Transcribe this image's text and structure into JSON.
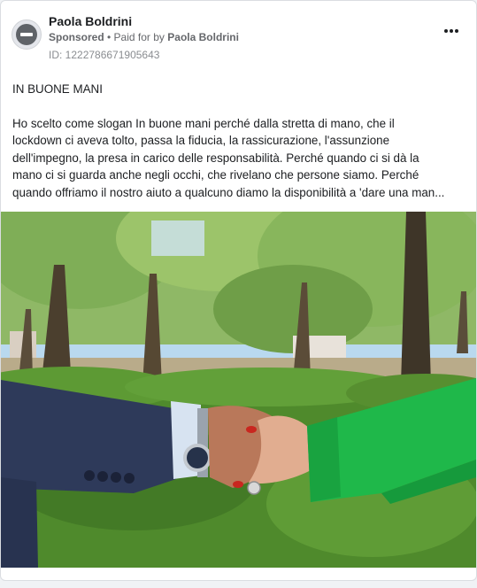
{
  "post": {
    "author": "Paola Boldrini",
    "sponsored": "Sponsored",
    "separator": " • ",
    "paid_for_by_label": "Paid for by",
    "paid_for_by_name": "Paola Boldrini",
    "ad_id": "ID: 1222786671905643",
    "headline": "IN BUONE MANI",
    "body_lines": [
      "Ho scelto come slogan In buone mani perché dalla stretta di mano, che il",
      "lockdown ci aveva tolto, passa la fiducia, la rassicurazione, l'assunzione",
      "dell'impegno, la presa in carico delle responsabilità. Perché quando ci si dà la",
      "mano ci si guarda anche negli occhi, che rivelano che persone siamo. Perché",
      "quando offriamo il nostro aiuto a qualcuno diamo la disponibilità a 'dare una man..."
    ]
  },
  "icons": {
    "avatar": "blocked-avatar-icon",
    "more": "more-options-icon"
  },
  "colors": {
    "card_bg": "#ffffff",
    "page_bg": "#f0f2f5",
    "text_primary": "#1c1e21",
    "text_secondary": "#65676b",
    "sleeve_left": "#2e3a5a",
    "sleeve_right": "#1fb84a"
  },
  "image": {
    "subject": "handshake-photo"
  }
}
